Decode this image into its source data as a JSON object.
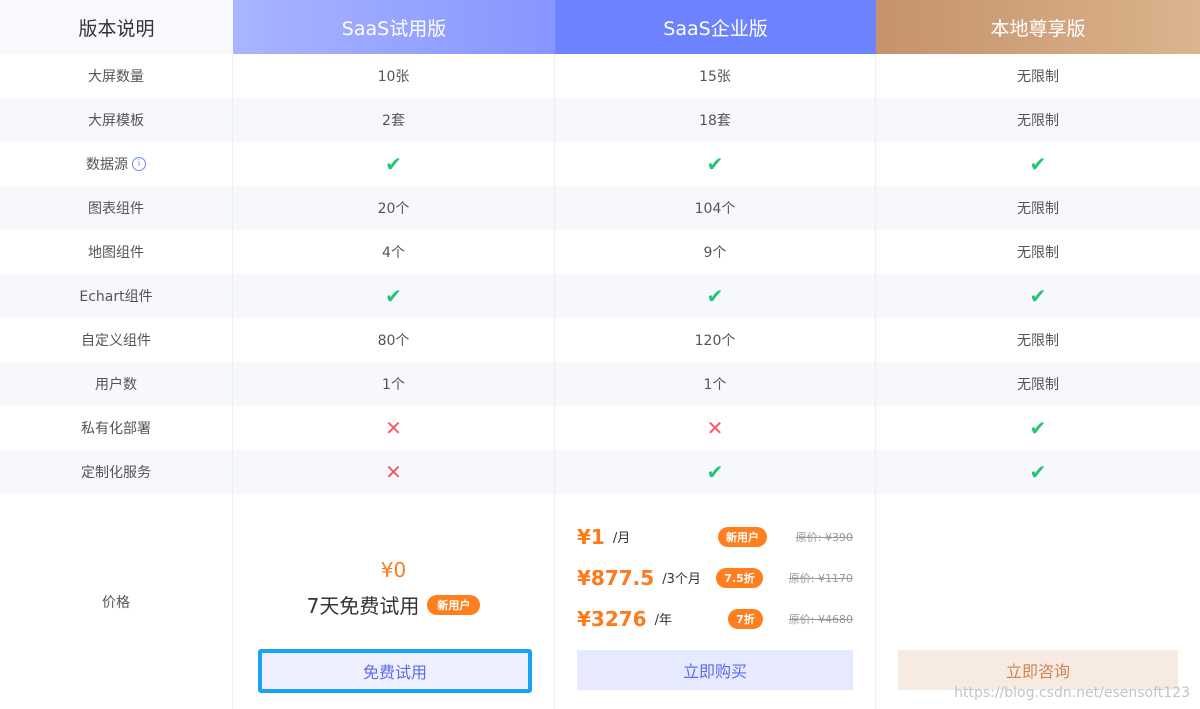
{
  "header": {
    "col0": "版本说明",
    "col1": "SaaS试用版",
    "col2": "SaaS企业版",
    "col3": "本地尊享版"
  },
  "features": [
    {
      "name": "大屏数量",
      "trial": "10张",
      "enterprise": "15张",
      "local": "无限制"
    },
    {
      "name": "大屏模板",
      "trial": "2套",
      "enterprise": "18套",
      "local": "无限制"
    },
    {
      "name": "数据源",
      "trial": "✔",
      "enterprise": "✔",
      "local": "✔"
    },
    {
      "name": "图表组件",
      "trial": "20个",
      "enterprise": "104个",
      "local": "无限制"
    },
    {
      "name": "地图组件",
      "trial": "4个",
      "enterprise": "9个",
      "local": "无限制"
    },
    {
      "name": "Echart组件",
      "trial": "✔",
      "enterprise": "✔",
      "local": "✔"
    },
    {
      "name": "自定义组件",
      "trial": "80个",
      "enterprise": "120个",
      "local": "无限制"
    },
    {
      "name": "用户数",
      "trial": "1个",
      "enterprise": "1个",
      "local": "无限制"
    },
    {
      "name": "私有化部署",
      "trial": "✕",
      "enterprise": "✕",
      "local": "✔"
    },
    {
      "name": "定制化服务",
      "trial": "✕",
      "enterprise": "✔",
      "local": "✔"
    }
  ],
  "info_icon_glyph": "i",
  "price": {
    "label": "价格",
    "trial": {
      "price": "¥0",
      "text": "7天免费试用",
      "badge": "新用户",
      "button": "免费试用"
    },
    "enterprise": {
      "options": [
        {
          "price": "¥1",
          "unit": "/月",
          "badge": "新用户",
          "original": "原价: ¥390"
        },
        {
          "price": "¥877.5",
          "unit": "/3个月",
          "badge": "7.5折",
          "original": "原价: ¥1170"
        },
        {
          "price": "¥3276",
          "unit": "/年",
          "badge": "7折",
          "original": "原价: ¥4680"
        }
      ],
      "button": "立即购买"
    },
    "local": {
      "button": "立即咨询"
    }
  },
  "watermark": "https://blog.csdn.net/esensoft123",
  "colors": {
    "trial_header": "#8795ff",
    "enterprise_header": "#6c82ff",
    "local_header": "#d0a37c",
    "check": "#23c476",
    "cross": "#f35a6a",
    "price": "#ff7a1a",
    "badge": "#ff7e1e"
  }
}
